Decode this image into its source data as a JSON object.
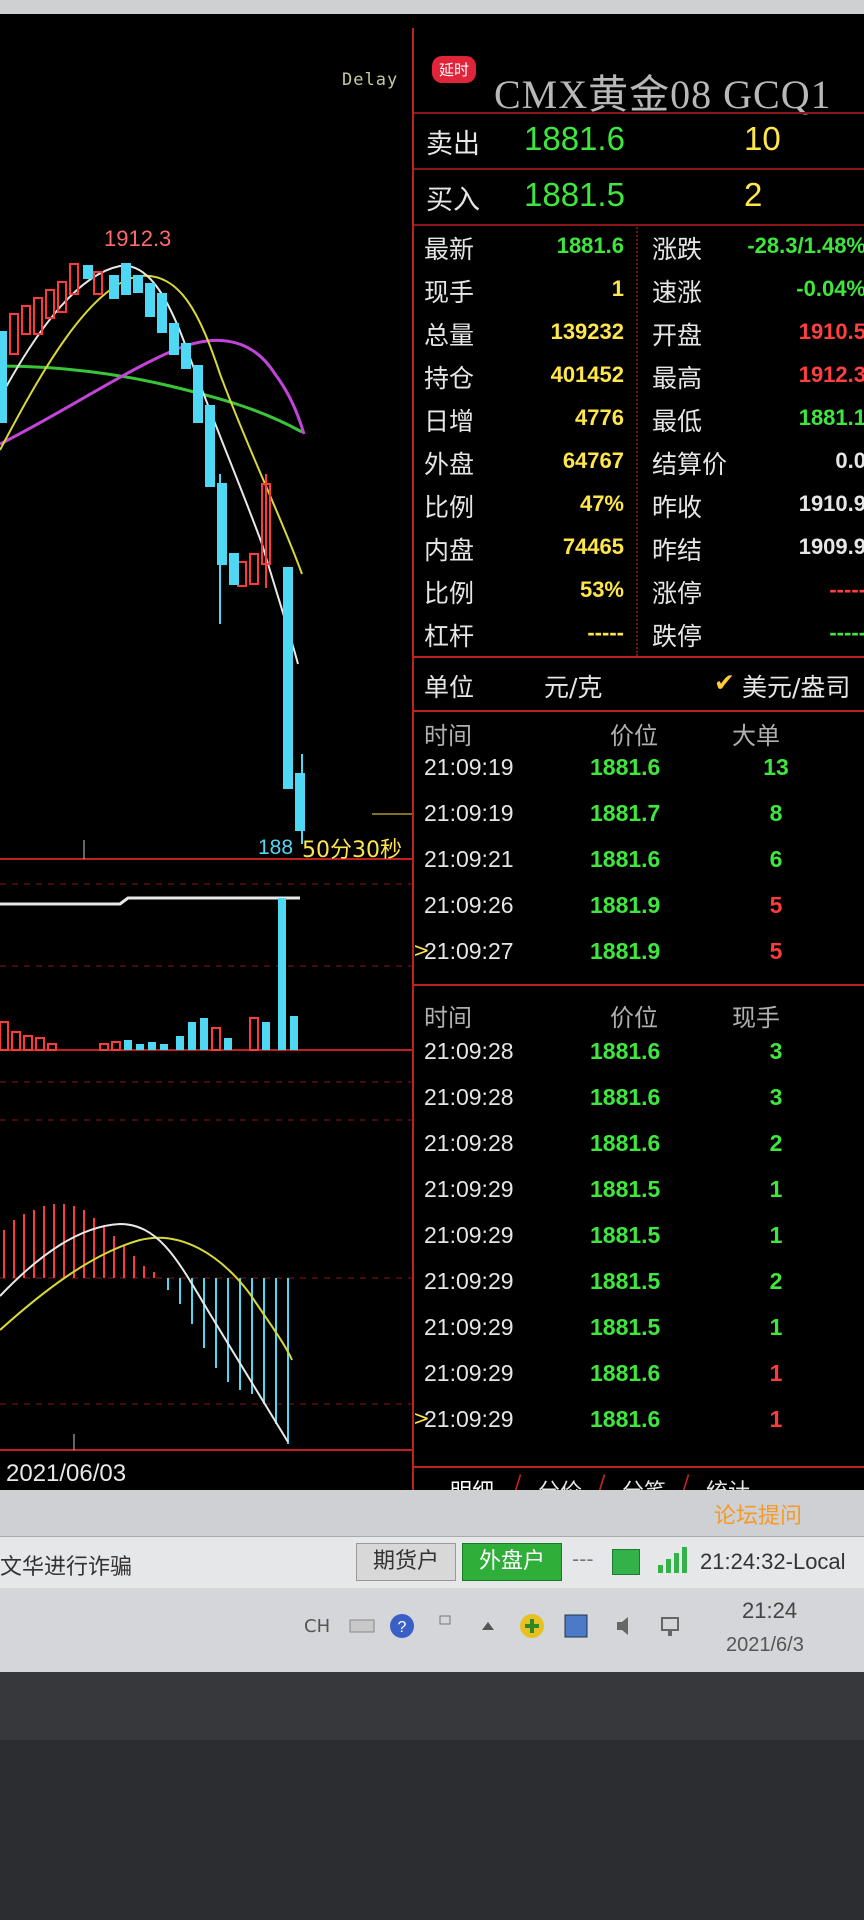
{
  "header": {
    "delay_indicator": "Delay",
    "delay_badge": "延时",
    "symbol": "CMX黄金08  GCQ1"
  },
  "order_book": {
    "sell_label": "卖出",
    "sell_price": "1881.6",
    "sell_volume": "10",
    "buy_label": "买入",
    "buy_price": "1881.5",
    "buy_volume": "2"
  },
  "quote": {
    "left": [
      {
        "label": "最新",
        "value": "1881.6",
        "color": "#3ee63e"
      },
      {
        "label": "现手",
        "value": "1",
        "color": "#ffe64a"
      },
      {
        "label": "总量",
        "value": "139232",
        "color": "#ffe64a"
      },
      {
        "label": "持仓",
        "value": "401452",
        "color": "#ffe64a"
      },
      {
        "label": "日增",
        "value": "4776",
        "color": "#ffe64a"
      },
      {
        "label": "外盘",
        "value": "64767",
        "color": "#ffe64a"
      },
      {
        "label": "比例",
        "value": "47%",
        "color": "#ffe64a"
      },
      {
        "label": "内盘",
        "value": "74465",
        "color": "#ffe64a"
      },
      {
        "label": "比例",
        "value": "53%",
        "color": "#ffe64a"
      },
      {
        "label": "杠杆",
        "value": "-----",
        "color": "#ffe64a"
      }
    ],
    "right": [
      {
        "label": "涨跌",
        "value": "-28.3/1.48%",
        "color": "#3ee63e"
      },
      {
        "label": "速涨",
        "value": "-0.04%",
        "color": "#3ee63e"
      },
      {
        "label": "开盘",
        "value": "1910.5",
        "color": "#ff4040"
      },
      {
        "label": "最高",
        "value": "1912.3",
        "color": "#ff4040"
      },
      {
        "label": "最低",
        "value": "1881.1",
        "color": "#3ee63e"
      },
      {
        "label": "结算价",
        "value": "0.0",
        "color": "#e6e6e6"
      },
      {
        "label": "昨收",
        "value": "1910.9",
        "color": "#e6e6e6"
      },
      {
        "label": "昨结",
        "value": "1909.9",
        "color": "#e6e6e6"
      },
      {
        "label": "涨停",
        "value": "-----",
        "color": "#ff4040"
      },
      {
        "label": "跌停",
        "value": "-----",
        "color": "#3ee63e"
      }
    ]
  },
  "unit": {
    "label": "单位",
    "value": "元/克",
    "check": "✔",
    "alt": "美元/盎司"
  },
  "big_orders": {
    "headers": [
      "时间",
      "价位",
      "大单"
    ],
    "rows": [
      {
        "time": "21:09:19",
        "price": "1881.6",
        "vol": "13",
        "color": "#3ee63e"
      },
      {
        "time": "21:09:19",
        "price": "1881.7",
        "vol": "8",
        "color": "#3ee63e"
      },
      {
        "time": "21:09:21",
        "price": "1881.6",
        "vol": "6",
        "color": "#3ee63e"
      },
      {
        "time": "21:09:26",
        "price": "1881.9",
        "vol": "5",
        "color": "#ff3a3a"
      },
      {
        "time": "21:09:27",
        "price": "1881.9",
        "vol": "5",
        "color": "#ff3a3a"
      }
    ]
  },
  "ticks": {
    "headers": [
      "时间",
      "价位",
      "现手"
    ],
    "rows": [
      {
        "time": "21:09:28",
        "price": "1881.6",
        "vol": "3",
        "color": "#3ee63e"
      },
      {
        "time": "21:09:28",
        "price": "1881.6",
        "vol": "3",
        "color": "#3ee63e"
      },
      {
        "time": "21:09:28",
        "price": "1881.6",
        "vol": "2",
        "color": "#3ee63e"
      },
      {
        "time": "21:09:29",
        "price": "1881.5",
        "vol": "1",
        "color": "#3ee63e"
      },
      {
        "time": "21:09:29",
        "price": "1881.5",
        "vol": "1",
        "color": "#3ee63e"
      },
      {
        "time": "21:09:29",
        "price": "1881.5",
        "vol": "2",
        "color": "#3ee63e"
      },
      {
        "time": "21:09:29",
        "price": "1881.5",
        "vol": "1",
        "color": "#3ee63e"
      },
      {
        "time": "21:09:29",
        "price": "1881.6",
        "vol": "1",
        "color": "#ff3a3a"
      },
      {
        "time": "21:09:29",
        "price": "1881.6",
        "vol": "1",
        "color": "#ff3a3a"
      }
    ]
  },
  "tabs": [
    "明细",
    "分价",
    "分笔",
    "统计"
  ],
  "chart": {
    "peak_label": "1912.3",
    "last_price_label": "188",
    "countdown": "50分30秒",
    "date_label": "2021/06/03"
  },
  "status": {
    "forum_link": "论坛提问",
    "notice": "文华进行诈骗",
    "futures_account": "期货户",
    "foreign_account": "外盘户",
    "dashes": "---",
    "time": "21:24:32-Local"
  },
  "taskbar": {
    "lang": "CH",
    "time": "21:24",
    "date": "2021/6/3"
  }
}
